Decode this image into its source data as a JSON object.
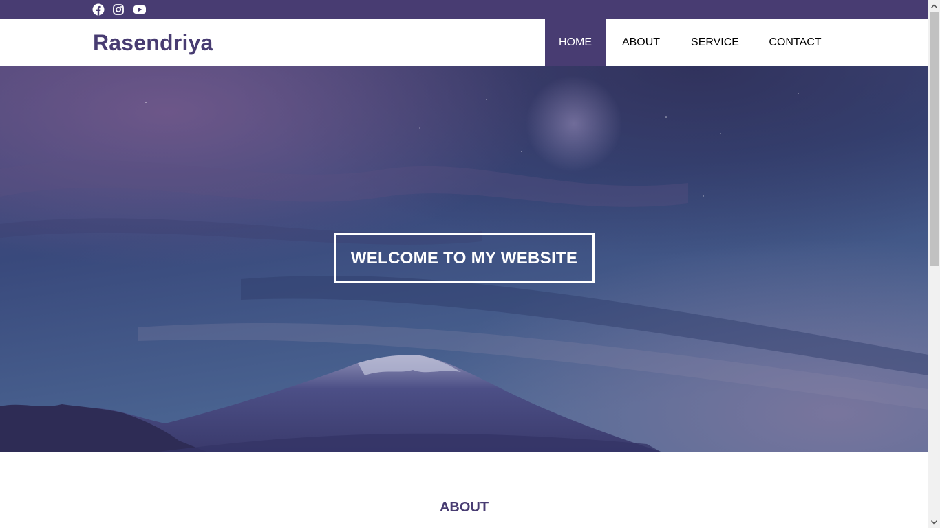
{
  "social": {
    "facebook_icon": "facebook-icon",
    "instagram_icon": "instagram-icon",
    "youtube_icon": "youtube-icon"
  },
  "header": {
    "brand": "Rasendriya",
    "nav": {
      "home": "HOME",
      "about": "ABOUT",
      "service": "SERVICE",
      "contact": "CONTACT"
    },
    "active_item": "HOME"
  },
  "hero": {
    "title": "WELCOME TO MY WEBSITE",
    "background": "night sky with crescent moon over snowy mountain"
  },
  "about": {
    "title": "ABOUT"
  },
  "colors": {
    "brand": "#483c72",
    "nav_active_bg": "#483c72",
    "hero_text": "#ffffff"
  }
}
